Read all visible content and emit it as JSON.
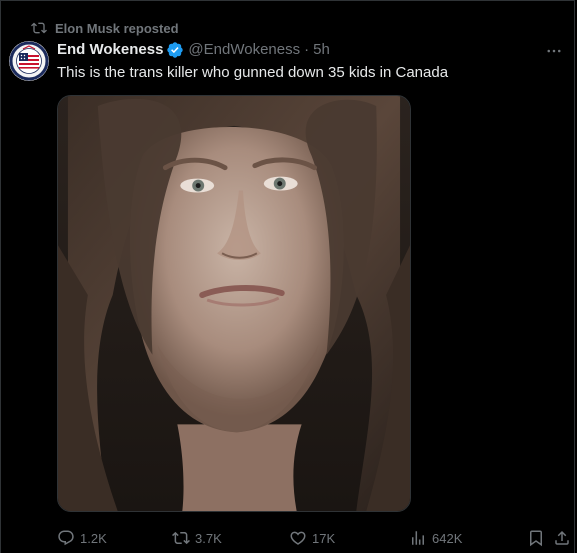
{
  "repost_banner": {
    "text": "Elon Musk reposted"
  },
  "author": {
    "display_name": "End Wokeness",
    "handle": "@EndWokeness",
    "separator": "·",
    "time": "5h",
    "verified": true
  },
  "avatar": {
    "icon": "patriot-emblem-avatar"
  },
  "tweet": {
    "text": "This is the trans killer who gunned down 35 kids in Canada"
  },
  "media": {
    "kind": "photo",
    "subject": "portrait"
  },
  "actions": {
    "replies": "1.2K",
    "reposts": "3.7K",
    "likes": "17K",
    "views": "642K"
  },
  "colors": {
    "background": "#000000",
    "text_primary": "#e7e9ea",
    "text_secondary": "#71767b",
    "verified_blue": "#1d9bf0",
    "border": "#2f3336"
  }
}
